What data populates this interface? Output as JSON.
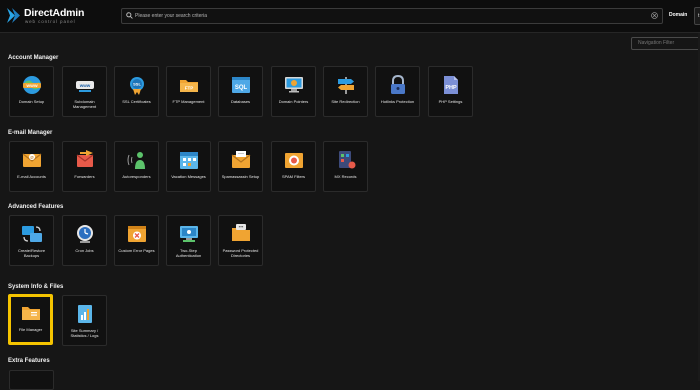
{
  "brand": {
    "name": "DirectAdmin",
    "tagline": "web control panel"
  },
  "search": {
    "placeholder": "Please enter your search criteria"
  },
  "header": {
    "domain_label": "Domain",
    "domain_button": "t"
  },
  "nav_filter": {
    "placeholder": "Navigation Filter"
  },
  "sections": {
    "account": {
      "title": "Account Manager",
      "items": [
        {
          "label": "Domain Setup"
        },
        {
          "label": "Subdomain Management"
        },
        {
          "label": "SSL Certificates"
        },
        {
          "label": "FTP Management"
        },
        {
          "label": "Databases"
        },
        {
          "label": "Domain Pointers"
        },
        {
          "label": "Site Redirection"
        },
        {
          "label": "Hotlinks Protection"
        },
        {
          "label": "PHP Settings"
        }
      ]
    },
    "email": {
      "title": "E-mail Manager",
      "items": [
        {
          "label": "E-mail Accounts"
        },
        {
          "label": "Forwarders"
        },
        {
          "label": "Autoresponders"
        },
        {
          "label": "Vacation Messages"
        },
        {
          "label": "Spamassassin Setup"
        },
        {
          "label": "SPAM Filters"
        },
        {
          "label": "MX Records"
        }
      ]
    },
    "advanced": {
      "title": "Advanced Features",
      "items": [
        {
          "label": "Create/Restore Backups"
        },
        {
          "label": "Cron Jobs"
        },
        {
          "label": "Custom Error Pages"
        },
        {
          "label": "Two-Step Authentication"
        },
        {
          "label": "Password Protected Directories"
        }
      ]
    },
    "sysinfo": {
      "title": "System Info & Files",
      "items": [
        {
          "label": "File Manager"
        },
        {
          "label": "Site Summary / Statistics / Logs"
        }
      ]
    },
    "extra": {
      "title": "Extra Features"
    }
  },
  "icons": {
    "www": "globe-www-icon",
    "sub": "subdomain-www-icon",
    "ssl": "ssl-badge-icon",
    "ftp": "ftp-folder-icon",
    "sql": "sql-database-icon",
    "pointer": "monitor-pointer-icon",
    "redirect": "signpost-icon",
    "lock": "padlock-icon",
    "php": "php-document-icon",
    "mail": "envelope-icon",
    "forward": "forward-arrow-icon",
    "auto": "auto-reply-icon",
    "vacation": "calendar-icon",
    "spam": "spam-envelope-icon",
    "spamfilter": "filter-shield-icon",
    "mx": "mx-records-icon",
    "backup": "backup-computer-icon",
    "cron": "clock-icon",
    "error": "error-page-icon",
    "twostep": "two-step-icon",
    "pwdir": "password-folder-icon",
    "folder": "folder-icon",
    "stats": "statistics-icon"
  },
  "colors": {
    "accent": "#f5c400",
    "brand": "#2aa6e8",
    "background": "#161616"
  }
}
